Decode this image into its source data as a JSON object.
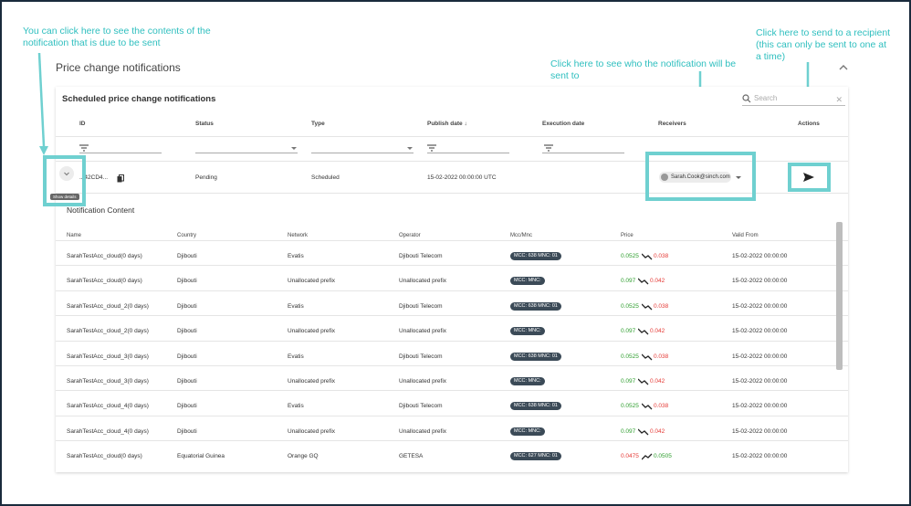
{
  "annotations": {
    "contents": "You can click here to see the contents of the notification that is due to be sent",
    "receivers": "Click here to see who the notification will be sent to",
    "send": "Click here to send to a recipient (this can only be sent to one at a time)"
  },
  "page": {
    "title": "Price change notifications"
  },
  "card": {
    "title": "Scheduled price change notifications",
    "search_placeholder": "Search",
    "headers": [
      "ID",
      "Status",
      "Type",
      "Publish date ↓",
      "Execution date",
      "Receivers",
      "Actions"
    ]
  },
  "row": {
    "id": "...42CD4...",
    "status": "Pending",
    "type": "Scheduled",
    "publish_date": "15-02-2022 00:00:00 UTC",
    "receiver": "Sarah.Cook@sinch.com",
    "tooltip": "Show details"
  },
  "content": {
    "title": "Notification Content",
    "headers": [
      "Name",
      "Country",
      "Network",
      "Operator",
      "Mcc/Mnc",
      "Price",
      "Valid From"
    ],
    "rows": [
      {
        "name": "SarahTestAcc_cloud(0 days)",
        "country": "Djibouti",
        "network": "Evatis",
        "operator": "Djibouti Telecom",
        "mccmnc": "MCC: 638 MNC: 01",
        "old": "0.0525",
        "new": "0.038",
        "dir": "down",
        "valid": "15-02-2022 00:00:00"
      },
      {
        "name": "SarahTestAcc_cloud(0 days)",
        "country": "Djibouti",
        "network": "Unallocated prefix",
        "operator": "Unallocated prefix",
        "mccmnc": "MCC: MNC:",
        "old": "0.097",
        "new": "0.042",
        "dir": "down",
        "valid": "15-02-2022 00:00:00"
      },
      {
        "name": "SarahTestAcc_cloud_2(0 days)",
        "country": "Djibouti",
        "network": "Evatis",
        "operator": "Djibouti Telecom",
        "mccmnc": "MCC: 638 MNC: 01",
        "old": "0.0525",
        "new": "0.038",
        "dir": "down",
        "valid": "15-02-2022 00:00:00"
      },
      {
        "name": "SarahTestAcc_cloud_2(0 days)",
        "country": "Djibouti",
        "network": "Unallocated prefix",
        "operator": "Unallocated prefix",
        "mccmnc": "MCC: MNC:",
        "old": "0.097",
        "new": "0.042",
        "dir": "down",
        "valid": "15-02-2022 00:00:00"
      },
      {
        "name": "SarahTestAcc_cloud_3(0 days)",
        "country": "Djibouti",
        "network": "Evatis",
        "operator": "Djibouti Telecom",
        "mccmnc": "MCC: 638 MNC: 01",
        "old": "0.0525",
        "new": "0.038",
        "dir": "down",
        "valid": "15-02-2022 00:00:00"
      },
      {
        "name": "SarahTestAcc_cloud_3(0 days)",
        "country": "Djibouti",
        "network": "Unallocated prefix",
        "operator": "Unallocated prefix",
        "mccmnc": "MCC: MNC:",
        "old": "0.097",
        "new": "0.042",
        "dir": "down",
        "valid": "15-02-2022 00:00:00"
      },
      {
        "name": "SarahTestAcc_cloud_4(0 days)",
        "country": "Djibouti",
        "network": "Evatis",
        "operator": "Djibouti Telecom",
        "mccmnc": "MCC: 638 MNC: 01",
        "old": "0.0525",
        "new": "0.038",
        "dir": "down",
        "valid": "15-02-2022 00:00:00"
      },
      {
        "name": "SarahTestAcc_cloud_4(0 days)",
        "country": "Djibouti",
        "network": "Unallocated prefix",
        "operator": "Unallocated prefix",
        "mccmnc": "MCC: MNC:",
        "old": "0.097",
        "new": "0.042",
        "dir": "down",
        "valid": "15-02-2022 00:00:00"
      },
      {
        "name": "SarahTestAcc_cloud(0 days)",
        "country": "Equatorial Guinea",
        "network": "Orange GQ",
        "operator": "GETESA",
        "mccmnc": "MCC: 627 MNC: 01",
        "old": "0.0475",
        "new": "0.0505",
        "dir": "up",
        "valid": "15-02-2022 00:00:00"
      }
    ]
  },
  "colors": {
    "accent": "#2fbfbf",
    "highlight": "#6fd0d0",
    "up": "#2e9e2e",
    "down": "#e53935",
    "tag": "#3b4a57"
  }
}
